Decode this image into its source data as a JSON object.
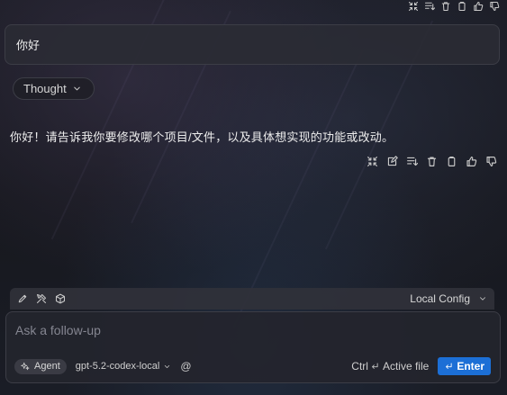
{
  "user_message": {
    "text": "你好"
  },
  "thought": {
    "label": "Thought"
  },
  "assistant_message": {
    "text": "你好！请告诉我你要修改哪个项目/文件，以及具体想实现的功能或改动。"
  },
  "message_actions": [
    "collapse-icon",
    "edit-icon",
    "insert-icon",
    "trash-icon",
    "copy-icon",
    "thumbs-up-icon",
    "thumbs-down-icon"
  ],
  "toolbar": {
    "icons": [
      "pencil-icon",
      "tools-icon",
      "cube-icon"
    ],
    "config_label": "Local Config"
  },
  "composer": {
    "placeholder": "Ask a follow-up",
    "agent_label": "Agent",
    "model_label": "gpt-5.2-codex-local",
    "at_symbol": "@",
    "active_file_ctrl": "Ctrl",
    "active_file_label": "Active file",
    "enter_label": "Enter"
  },
  "colors": {
    "accent": "#1c6fd6",
    "background": "#15161c"
  }
}
